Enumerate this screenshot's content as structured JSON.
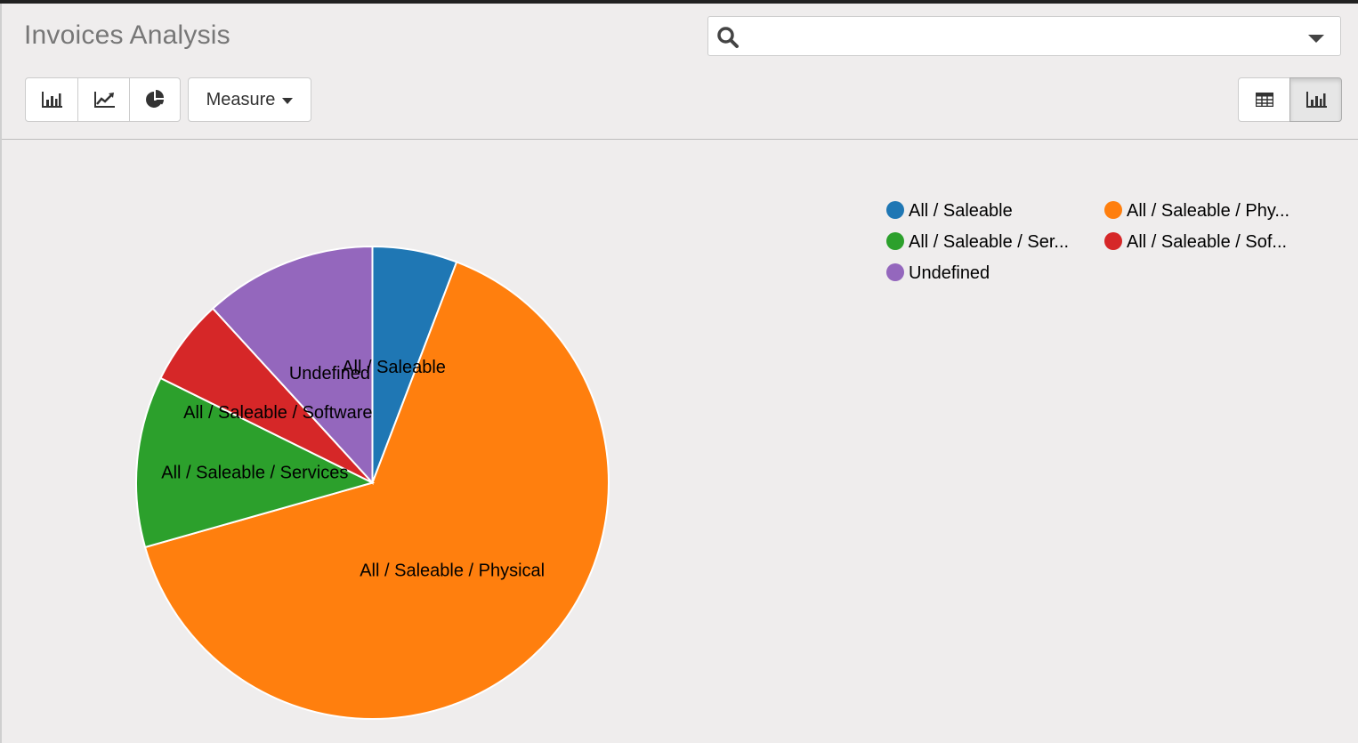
{
  "header": {
    "title": "Invoices Analysis"
  },
  "search": {
    "value": "",
    "placeholder": "",
    "icon": "search-icon",
    "dropdown_icon": "caret-down-icon"
  },
  "chart_type_buttons": [
    {
      "name": "bar-chart",
      "icon": "bar-chart-icon",
      "active": false
    },
    {
      "name": "line-chart",
      "icon": "line-chart-icon",
      "active": false
    },
    {
      "name": "pie-chart",
      "icon": "pie-chart-icon",
      "active": false
    }
  ],
  "measure_button": {
    "label": "Measure"
  },
  "view_switcher": [
    {
      "name": "pivot",
      "icon": "table-icon",
      "active": false
    },
    {
      "name": "graph",
      "icon": "bar-chart-icon",
      "active": true
    }
  ],
  "chart_data": {
    "type": "pie",
    "title": "",
    "unit": "percent",
    "slices": [
      {
        "label": "All / Saleable",
        "legend": "All / Saleable",
        "value": 5.8,
        "color": "#1f77b4"
      },
      {
        "label": "All / Saleable / Physical",
        "legend": "All / Saleable / Phy...",
        "value": 64.8,
        "color": "#ff7f0e"
      },
      {
        "label": "All / Saleable / Services",
        "legend": "All / Saleable / Ser...",
        "value": 11.7,
        "color": "#2ca02c"
      },
      {
        "label": "All / Saleable / Software",
        "legend": "All / Saleable / Sof...",
        "value": 5.9,
        "color": "#d62728"
      },
      {
        "label": "Undefined",
        "legend": "Undefined",
        "value": 11.8,
        "color": "#9467bd"
      }
    ],
    "legend_position": "top-right",
    "start_angle": "12 o'clock, clockwise"
  }
}
